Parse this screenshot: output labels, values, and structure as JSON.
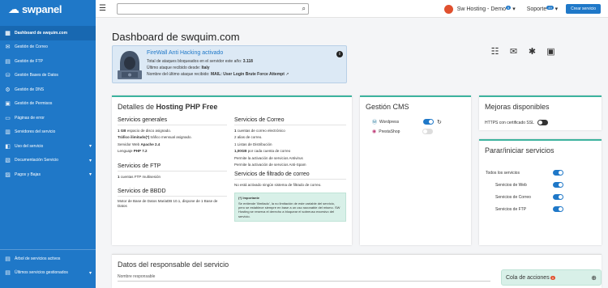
{
  "brand": {
    "name": "swpanel"
  },
  "sidebar": {
    "items": [
      {
        "icon": "dashboard-icon",
        "glyph": "▦",
        "label": "Dashboard de swquim.com",
        "active": true
      },
      {
        "icon": "mail-icon",
        "glyph": "✉",
        "label": "Gestión de Correo"
      },
      {
        "icon": "ftp-icon",
        "glyph": "▤",
        "label": "Gestión de FTP"
      },
      {
        "icon": "database-icon",
        "glyph": "⛁",
        "label": "Gestión Bases de Datos"
      },
      {
        "icon": "dns-icon",
        "glyph": "⚙",
        "label": "Gestión de DNS"
      },
      {
        "icon": "permissions-icon",
        "glyph": "▣",
        "label": "Gestión de Permisos"
      },
      {
        "icon": "error-pages-icon",
        "glyph": "▭",
        "label": "Páginas de error"
      },
      {
        "icon": "services-icon",
        "glyph": "▥",
        "label": "Servidores del servicio"
      },
      {
        "icon": "web-icon",
        "glyph": "◧",
        "label": "Uso del servicio",
        "caret": true
      },
      {
        "icon": "docs-icon",
        "glyph": "▧",
        "label": "Documentación Servicio",
        "caret": true
      },
      {
        "icon": "payments-icon",
        "glyph": "▨",
        "label": "Pagos y Bajas",
        "caret": true
      }
    ],
    "bottom": [
      {
        "icon": "tree-icon",
        "glyph": "▤",
        "label": "Árbol de servicios activos"
      },
      {
        "icon": "history-icon",
        "glyph": "▤",
        "label": "Últimos servicios gestionados",
        "caret": true
      }
    ]
  },
  "topbar": {
    "search_placeholder": "",
    "account": "Sw Hosting - Demo",
    "account_badge": "5",
    "support": "Soporte",
    "support_badge": "49",
    "create_button": "Crear servicio"
  },
  "page": {
    "title": "Dashboard de swquim.com"
  },
  "firewall": {
    "title": "FireWall Anti Hacking activado",
    "line1_label": "Total de ataques bloqueados en el servidor este año",
    "line1_value": "3.118",
    "line2_label": "Último ataque recibido desde",
    "line2_value": "Italy",
    "line3_label": "Nombre del último ataque recibido",
    "line3_value": "MAIL: User Login Brute Force Attempt"
  },
  "plan": {
    "title_prefix": "Detalles de",
    "title_strong": "Hosting PHP Free",
    "general_title": "Servicios generales",
    "general": [
      {
        "strong": "1 GB",
        "text": " espacio de disco asignado."
      },
      {
        "strong": "Tráfico ilimitado(*)",
        "text": " tráfico mensual asignado."
      },
      {
        "strong": "",
        "text": "Servidor Web ",
        "strong2": "Apache 2.4"
      },
      {
        "strong": "",
        "text": "Lenguaje ",
        "strong2": "PHP 7.2"
      }
    ],
    "ftp_title": "Servicios de FTP",
    "ftp": [
      {
        "strong": "1",
        "text": " cuentas FTP multisesión"
      }
    ],
    "db_title": "Servicios de BBDD",
    "db": "Motor de Base de Datos MariaDB 10.1, dispone de 1 Base de Datos",
    "mail_title": "Servicios de Correo",
    "mail": [
      {
        "strong": "1",
        "text": " cuentas de correo electrónico"
      },
      {
        "strong": "",
        "text": "2 alias de correo."
      },
      {
        "strong": "",
        "text": "1 Listas de Distribución"
      },
      {
        "strong": "1,00GB",
        "text": " por cada cuenta de correo"
      },
      {
        "strong": "",
        "text": "Permite la activación de servicios Antivirus"
      },
      {
        "strong": "",
        "text": "Permite la activación de servicios Anti-Spam"
      }
    ],
    "filter_title": "Servicios de filtrado de correo",
    "filter": "No está activado ningún sistema de filtrado de correo.",
    "note_title": "(*) Importante",
    "note": "Se entiende 'ilimitado', la no limitación de este variable del servicio, pero se establece siempre en base a un uso razonable del mismo. SW Hosting se reserva el derecho a bloquear el sobreuso excesivo del servicio."
  },
  "cms": {
    "title": "Gestión CMS",
    "items": [
      {
        "name": "Wordpress",
        "enabled": true
      },
      {
        "name": "PrestaShop",
        "enabled": false
      }
    ]
  },
  "improvements": {
    "title": "Mejoras disponibles",
    "items": [
      {
        "name": "HTTPS con certificado SSL",
        "enabled": false
      }
    ]
  },
  "services": {
    "title": "Parar/iniciar servicios",
    "all_label": "Todos los servicios",
    "items": [
      {
        "name": "Servicios de Web",
        "enabled": true
      },
      {
        "name": "Servicios de Correo",
        "enabled": true
      },
      {
        "name": "Servicios de FTP",
        "enabled": true
      }
    ]
  },
  "responsible": {
    "title": "Datos del responsable del servicio",
    "name_label": "Nombre responsable"
  },
  "queue": {
    "label": "Cola de acciones",
    "badge": "0"
  },
  "colors": {
    "primary": "#1f78c8",
    "accent": "#3cb39e"
  }
}
